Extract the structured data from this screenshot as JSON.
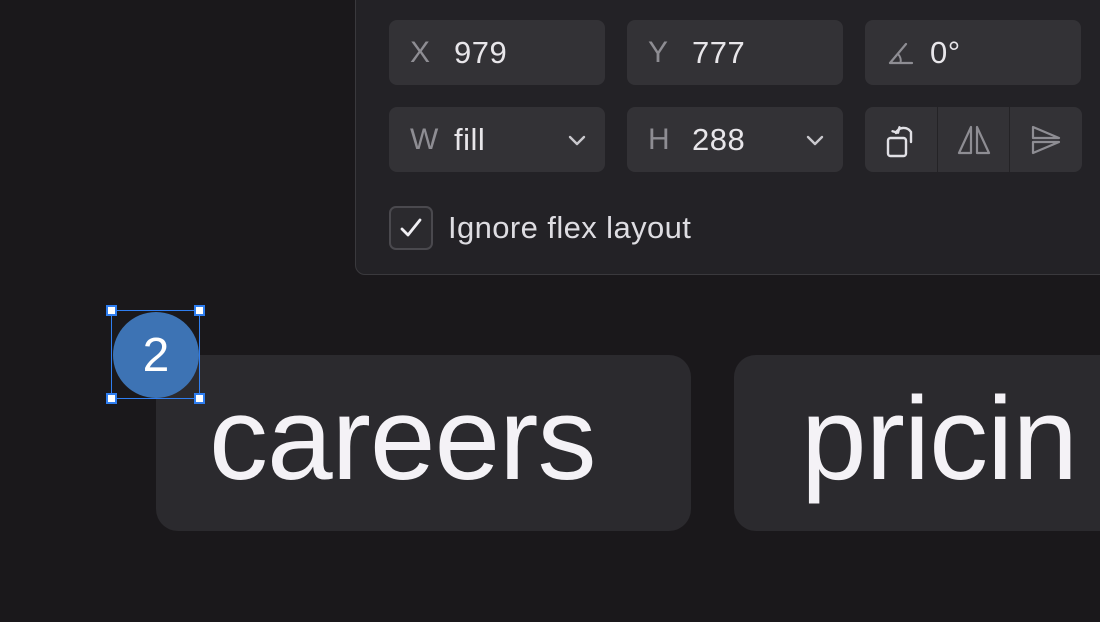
{
  "panel": {
    "x": {
      "axis": "X",
      "value": "979"
    },
    "y": {
      "axis": "Y",
      "value": "777"
    },
    "rotation": {
      "value": "0°"
    },
    "w": {
      "axis": "W",
      "value": "fill"
    },
    "h": {
      "axis": "H",
      "value": "288"
    },
    "ignore_flex": {
      "label": "Ignore flex layout",
      "checked": true
    }
  },
  "canvas": {
    "nav_items": [
      {
        "label": "careers"
      },
      {
        "label": "pricin"
      }
    ],
    "badge": {
      "label": "2",
      "color": "#3d73b4"
    },
    "selection_color": "#2f7ef0"
  }
}
